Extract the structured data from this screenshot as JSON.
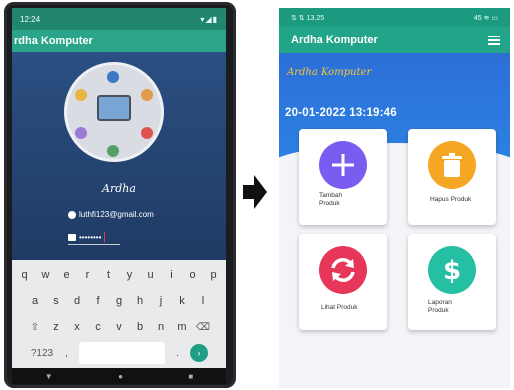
{
  "left_phone": {
    "status_time": "12:24",
    "status_icons": "▾◢▮",
    "app_title": "rdha Komputer",
    "brand_script": "Ardha",
    "email": "luthfi123@gmail.com",
    "password_mask": "••••••••",
    "keyboard": {
      "row1": [
        "q",
        "w",
        "e",
        "r",
        "t",
        "y",
        "u",
        "i",
        "o",
        "p"
      ],
      "row2": [
        "a",
        "s",
        "d",
        "f",
        "g",
        "h",
        "j",
        "k",
        "l"
      ],
      "row3": [
        "z",
        "x",
        "c",
        "v",
        "b",
        "n",
        "m"
      ],
      "fn_left": "?123",
      "shift_icon": "shift-icon",
      "delete_icon": "backspace-icon"
    },
    "nav": [
      "▼",
      "●",
      "■"
    ]
  },
  "right_phone": {
    "status_left": "⇅ ⇅ 13.25",
    "status_right": "45 ≋ ▭",
    "app_title": "Ardha Komputer",
    "menu_icon": "hamburger-icon",
    "brand_script": "Ardha Komputer",
    "datetime": "20-01-2022 13:19:46",
    "cards": [
      {
        "label": "Tambah\nProduk",
        "icon": "plus-icon",
        "color": "#7b5cf0"
      },
      {
        "label": "Hapus Produk",
        "icon": "trash-icon",
        "color": "#f5a623"
      },
      {
        "label": "Lihat Produk",
        "icon": "refresh-icon",
        "color": "#e6365a"
      },
      {
        "label": "Laporan\nProduk",
        "icon": "dollar-icon",
        "color": "#25c0a4"
      }
    ]
  },
  "colors": {
    "teal_bar": "#22a489",
    "blue_hero": "#2c6fd6",
    "script_yellow": "#f6c63a"
  }
}
